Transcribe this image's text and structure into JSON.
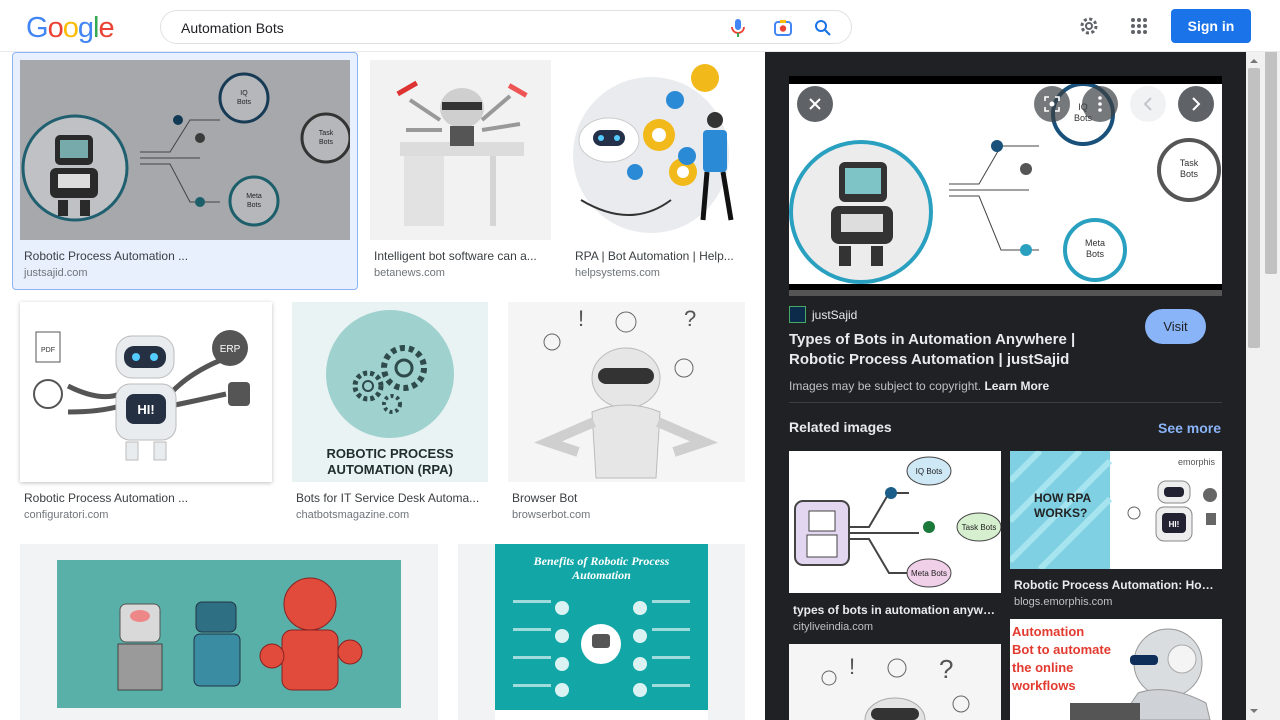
{
  "header": {
    "logo": [
      "G",
      "o",
      "o",
      "g",
      "l",
      "e"
    ],
    "logo_colors": [
      "#4285f4",
      "#ea4335",
      "#fbbc05",
      "#4285f4",
      "#34a853",
      "#ea4335"
    ],
    "search_value": "Automation Bots",
    "signin_label": "Sign in"
  },
  "results": [
    {
      "caption": "Robotic Process Automation ...",
      "source": "justsajid.com",
      "thumb_label": "",
      "selected": true
    },
    {
      "caption": "Intelligent bot software can a...",
      "source": "betanews.com",
      "thumb_label": ""
    },
    {
      "caption": "RPA | Bot Automation | Help...",
      "source": "helpsystems.com",
      "thumb_label": ""
    },
    {
      "caption": "Robotic Process Automation ...",
      "source": "configuratori.com",
      "thumb_label": "HI!"
    },
    {
      "caption": "Bots for IT Service Desk Automa...",
      "source": "chatbotsmagazine.com",
      "thumb_label": "ROBOTIC PROCESS AUTOMATION (RPA)"
    },
    {
      "caption": "Browser Bot",
      "source": "browserbot.com",
      "thumb_label": ""
    },
    {
      "caption": "",
      "source": "",
      "thumb_label": ""
    },
    {
      "caption": "",
      "source": "",
      "thumb_label": "Benefits of Robotic Process Automation"
    }
  ],
  "diagram_labels": {
    "iq": "IQ\nBots",
    "task": "Task\nBots",
    "meta": "Meta\nBots"
  },
  "panel": {
    "source_name": "justSajid",
    "title": "Types of Bots in Automation Anywhere | Robotic Process Automation | justSajid",
    "visit_label": "Visit",
    "copyright_text": "Images may be subject to copyright.",
    "learn_more": "Learn More",
    "related_heading": "Related images",
    "see_more": "See more",
    "related": [
      {
        "caption": "types of bots in automation anywhe...",
        "source": "citylivein­dia.com"
      },
      {
        "caption": "Robotic Process Automation: How ...",
        "source": "blogs.emorphis.com"
      },
      {
        "caption": "",
        "source": ""
      },
      {
        "caption": "",
        "source": ""
      }
    ],
    "related_texts": {
      "how_rpa": "HOW RPA WORKS?",
      "emorphis": "emorphis",
      "automation": "Automation",
      "bot_to_automate": "Bot to automate",
      "the_online": "the online",
      "workflows": "workflows"
    }
  },
  "colors": {
    "accent": "#1a73e8",
    "panel_bg": "#202124",
    "link_blue": "#8ab4f8"
  }
}
